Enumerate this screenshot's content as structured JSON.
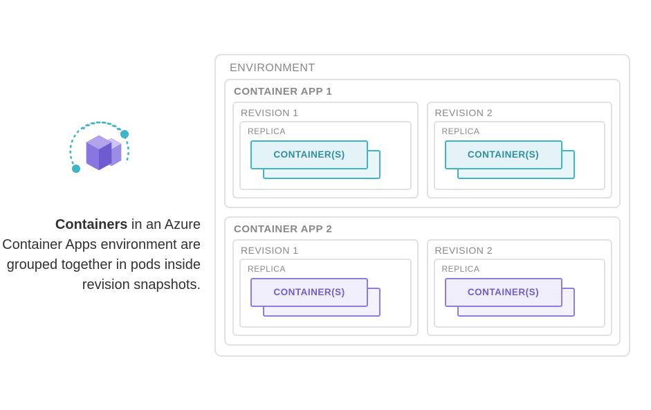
{
  "left": {
    "description_strong": "Containers",
    "description_rest": " in an Azure Container Apps environment are grouped together in pods inside revision snapshots."
  },
  "env": {
    "label": "ENVIRONMENT",
    "apps": [
      {
        "label": "CONTAINER APP 1",
        "color": "teal",
        "revisions": [
          {
            "label": "REVISION 1",
            "replica_label": "REPLICA",
            "container_label": "CONTAINER(S)"
          },
          {
            "label": "REVISION 2",
            "replica_label": "REPLICA",
            "container_label": "CONTAINER(S)"
          }
        ]
      },
      {
        "label": "CONTAINER APP 2",
        "color": "purple",
        "revisions": [
          {
            "label": "REVISION 1",
            "replica_label": "REPLICA",
            "container_label": "CONTAINER(S)"
          },
          {
            "label": "REVISION 2",
            "replica_label": "REPLICA",
            "container_label": "CONTAINER(S)"
          }
        ]
      }
    ]
  }
}
